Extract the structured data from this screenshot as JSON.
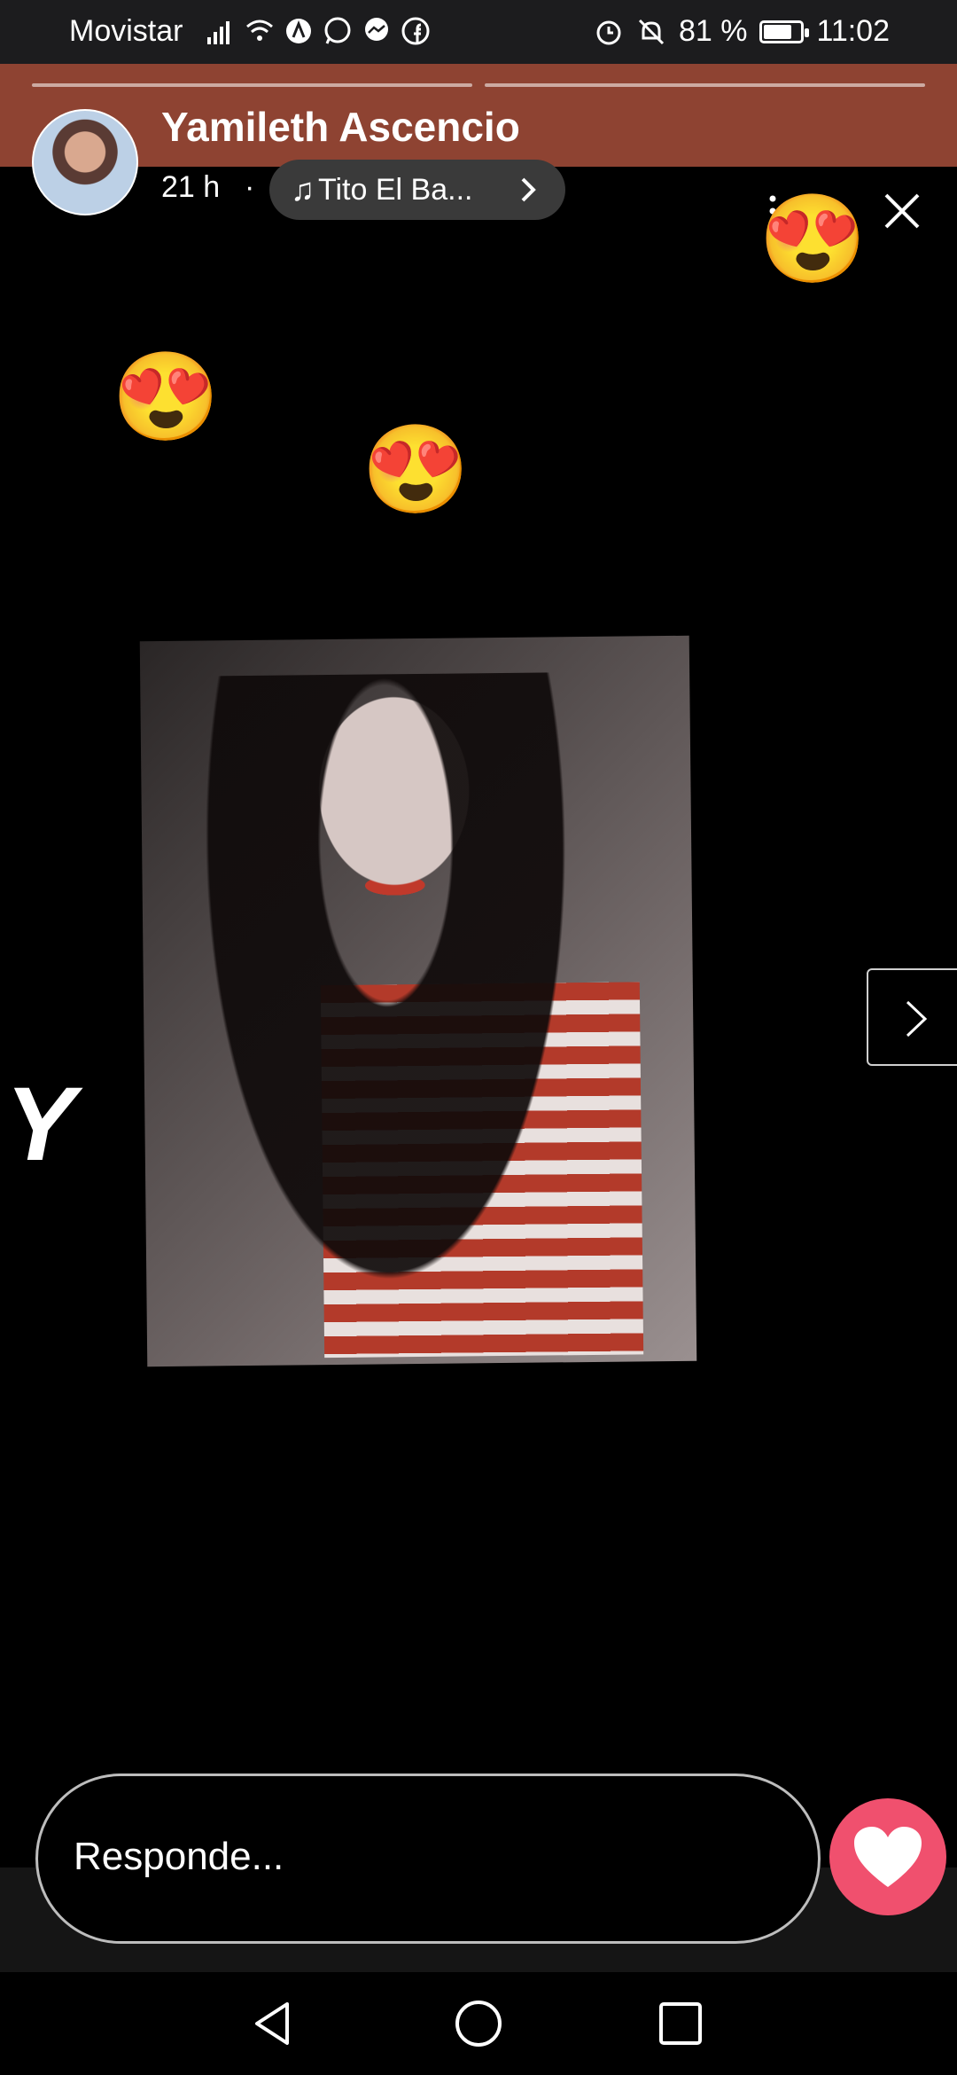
{
  "status_bar": {
    "carrier": "Movistar",
    "battery_percent": "81 %",
    "time": "11:02",
    "icons": [
      "signal-icon",
      "wifi-icon",
      "app-icon",
      "whatsapp-icon",
      "messenger-icon",
      "facebook-icon",
      "alarm-icon",
      "mute-icon",
      "battery-icon"
    ]
  },
  "story": {
    "username": "Yamileth Ascencio",
    "time_ago": "21 h",
    "separator": "·",
    "music_label": "Tito El Ba...",
    "progress_segments": 2,
    "side_letter": "Y"
  },
  "reply": {
    "placeholder": "Responde..."
  },
  "colors": {
    "header_band": "#8e4332",
    "like_button": "#f0506e",
    "background": "#000000"
  },
  "navigation": {
    "icons": [
      "back-icon",
      "home-icon",
      "recents-icon"
    ]
  }
}
